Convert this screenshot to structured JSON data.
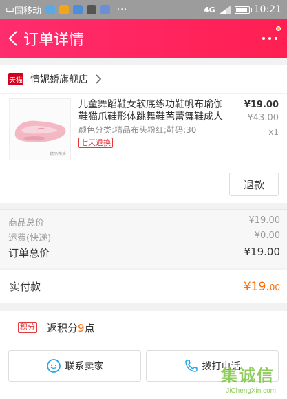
{
  "status_bar": {
    "carrier": "中国移动",
    "network": "4G",
    "signal_label": "4G",
    "time": "10:21",
    "more": "···"
  },
  "header": {
    "title": "订单详情"
  },
  "shop": {
    "logo_text": "天猫",
    "name": "情妮娇旗舰店"
  },
  "product": {
    "title": "儿童舞蹈鞋女软底练功鞋帆布瑜伽鞋猫爪鞋形体跳舞鞋芭蕾舞鞋成人",
    "sku": "颜色分类:精品布头粉红;鞋码:30",
    "badge": "七天退换",
    "price": "¥19.00",
    "original_price": "¥43.00",
    "quantity": "x1",
    "refund_label": "退款",
    "image_caption": "精品布头"
  },
  "summary": {
    "goods_total_label": "商品总价",
    "goods_total_value": "¥19.00",
    "shipping_label": "运费(快递)",
    "shipping_value": "¥0.00",
    "order_total_label": "订单总价",
    "order_total_value": "¥19.00"
  },
  "paid": {
    "label": "实付款",
    "amount_int": "¥19.",
    "amount_dec": "00"
  },
  "points": {
    "badge": "积分",
    "text_prefix": "返积分",
    "value": "9",
    "text_suffix": "点"
  },
  "actions": {
    "contact_label": "联系卖家",
    "call_label": "拨打电话"
  },
  "watermark": {
    "main": "集诚信",
    "sub": "JiChengXin.com"
  },
  "colors": {
    "header": "#ff2c6e",
    "accent_orange": "#ff6c00",
    "tmall_red": "#d4001d",
    "badge_red": "#e4393c"
  }
}
